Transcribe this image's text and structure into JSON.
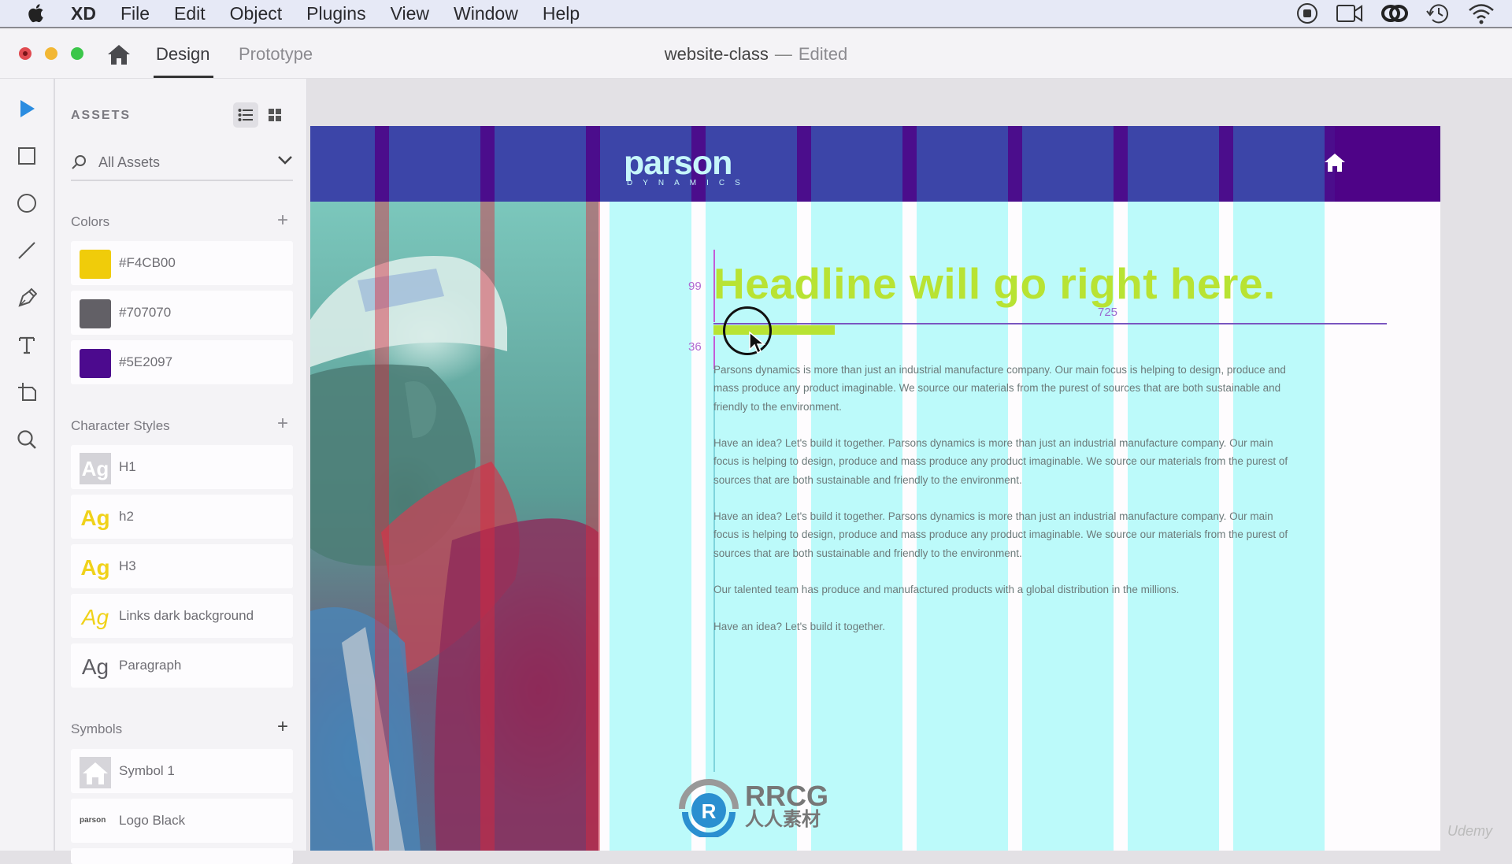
{
  "menubar": {
    "app_name": "XD",
    "items": [
      "File",
      "Edit",
      "Object",
      "Plugins",
      "View",
      "Window",
      "Help"
    ],
    "status_icons": [
      "screen-record-icon",
      "facetime-camera-icon",
      "creative-cloud-icon",
      "time-machine-icon",
      "wifi-icon"
    ]
  },
  "titlebar": {
    "tabs": [
      {
        "label": "Design",
        "active": true
      },
      {
        "label": "Prototype",
        "active": false
      }
    ],
    "document_name": "website-class",
    "separator": "—",
    "document_status": "Edited"
  },
  "toolbar": {
    "tools": [
      "select",
      "rectangle",
      "ellipse",
      "line",
      "pen",
      "text",
      "artboard",
      "zoom"
    ]
  },
  "assets": {
    "title": "ASSETS",
    "filter_label": "All Assets",
    "colors_heading": "Colors",
    "colors": [
      {
        "hex": "#F4CB00",
        "label": "#F4CB00"
      },
      {
        "hex": "#707070",
        "label": "#707070"
      },
      {
        "hex": "#5E2097",
        "label": "#5E2097"
      }
    ],
    "character_styles_heading": "Character Styles",
    "character_styles": [
      {
        "sample": "Ag",
        "label": "H1"
      },
      {
        "sample": "Ag",
        "label": "h2"
      },
      {
        "sample": "Ag",
        "label": "H3"
      },
      {
        "sample": "Ag",
        "label": "Links dark background"
      },
      {
        "sample": "Ag",
        "label": "Paragraph"
      }
    ],
    "symbols_heading": "Symbols",
    "symbols": [
      {
        "label": "Symbol 1",
        "thumb": "house"
      },
      {
        "label": "Logo Black",
        "thumb": "parson"
      }
    ]
  },
  "artboard": {
    "logo_word": "parson",
    "logo_sub": "DYNAMICS",
    "headline": "Headline will go right here.",
    "measure_above": "99",
    "measure_below": "36",
    "measure_width": "725",
    "paragraphs": [
      "Parsons dynamics is more than just an industrial manufacture company. Our main focus is helping to design, produce and mass produce any product imaginable. We source our materials from the purest of sources that are both sustainable and friendly to the environment.",
      "Have an idea? Let's build it together. Parsons dynamics is more than just an industrial manufacture company. Our main focus is helping to design, produce and mass produce any product imaginable. We source our materials from the purest of sources that are both sustainable and friendly to the environment.",
      "Have an idea? Let's build it together. Parsons dynamics is more than just an industrial manufacture company. Our main focus is helping to design, produce and mass produce any product imaginable. We source our materials from the purest of sources that are both sustainable and friendly to the environment.",
      "Our talented team has produce and manufactured products with a global distribution in the millions.",
      "Have an idea? Let's build it together."
    ]
  },
  "watermark": {
    "line1": "RRCG",
    "line2": "人人素材",
    "udemy": "Udemy"
  },
  "colors": {
    "header_blue": "#3c45a8",
    "header_purple": "#4e0387",
    "headline_green": "#b8e333",
    "grid_cyan": "#bcfafa"
  }
}
